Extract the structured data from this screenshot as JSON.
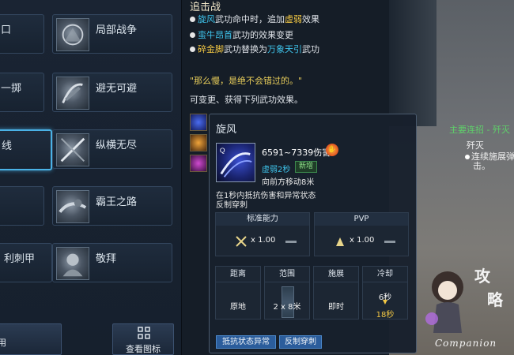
{
  "grid": {
    "items": [
      {
        "name": "口"
      },
      {
        "name": "局部战争"
      },
      {
        "name": "一掷"
      },
      {
        "name": "避无可避"
      },
      {
        "name": "线"
      },
      {
        "name": "纵横无尽"
      },
      {
        "name": ""
      },
      {
        "name": "霸王之路"
      },
      {
        "name": "利刺甲"
      },
      {
        "name": "敬拜"
      }
    ],
    "bottom_left_label": "用",
    "view_icons_label": "查看图标"
  },
  "info": {
    "title": "追击战",
    "effects": [
      {
        "a": "旋风",
        "b": "武功命中时，追加",
        "c": "虚弱",
        "d": "效果"
      },
      {
        "a": "蛮牛昂首",
        "b": "武功的效果变更",
        "c": "",
        "d": ""
      },
      {
        "a": "碎金脚",
        "b": "武功替换为",
        "c": "万象天引",
        "d": "武功"
      }
    ],
    "quote": "\"那么慢，是绝不会错过的。\"",
    "changeable": "可变更、获得下列武功效果。"
  },
  "tooltip": {
    "title": "旋风",
    "damage": "6591~7339伤害",
    "weak": "虚弱2秒",
    "new_badge": "新增",
    "move": "向前方移动8米",
    "desc1": "在1秒内抵抗伤害和异常状态",
    "desc2": "反制穿刺",
    "standard": {
      "label": "标准能力",
      "value": "x 1.00"
    },
    "pvp": {
      "label": "PVP",
      "value": "x 1.00"
    },
    "cells": {
      "distance": {
        "head": "距离",
        "value": "原地"
      },
      "range": {
        "head": "范围",
        "value": "2 x 8米"
      },
      "cast": {
        "head": "施展",
        "value": "即时"
      },
      "cooldown": {
        "head": "冷却",
        "value_top": "6秒",
        "value_bottom": "18秒"
      }
    },
    "tags": [
      "抵抗状态异常",
      "反制穿刺"
    ]
  },
  "world": {
    "quest_line": "主要连招 - 歼灭",
    "skill_name": "歼灭",
    "skill_desc1": "连续施展弹",
    "skill_desc2": "击。"
  },
  "companion": {
    "label": "Companion",
    "chars": [
      "攻",
      "略"
    ]
  },
  "colors": {
    "accent_cyan": "#3fc6ee",
    "accent_yellow": "#f2c744",
    "selected_border": "#4ab2e6",
    "tag_blue": "#2b5d9c"
  }
}
